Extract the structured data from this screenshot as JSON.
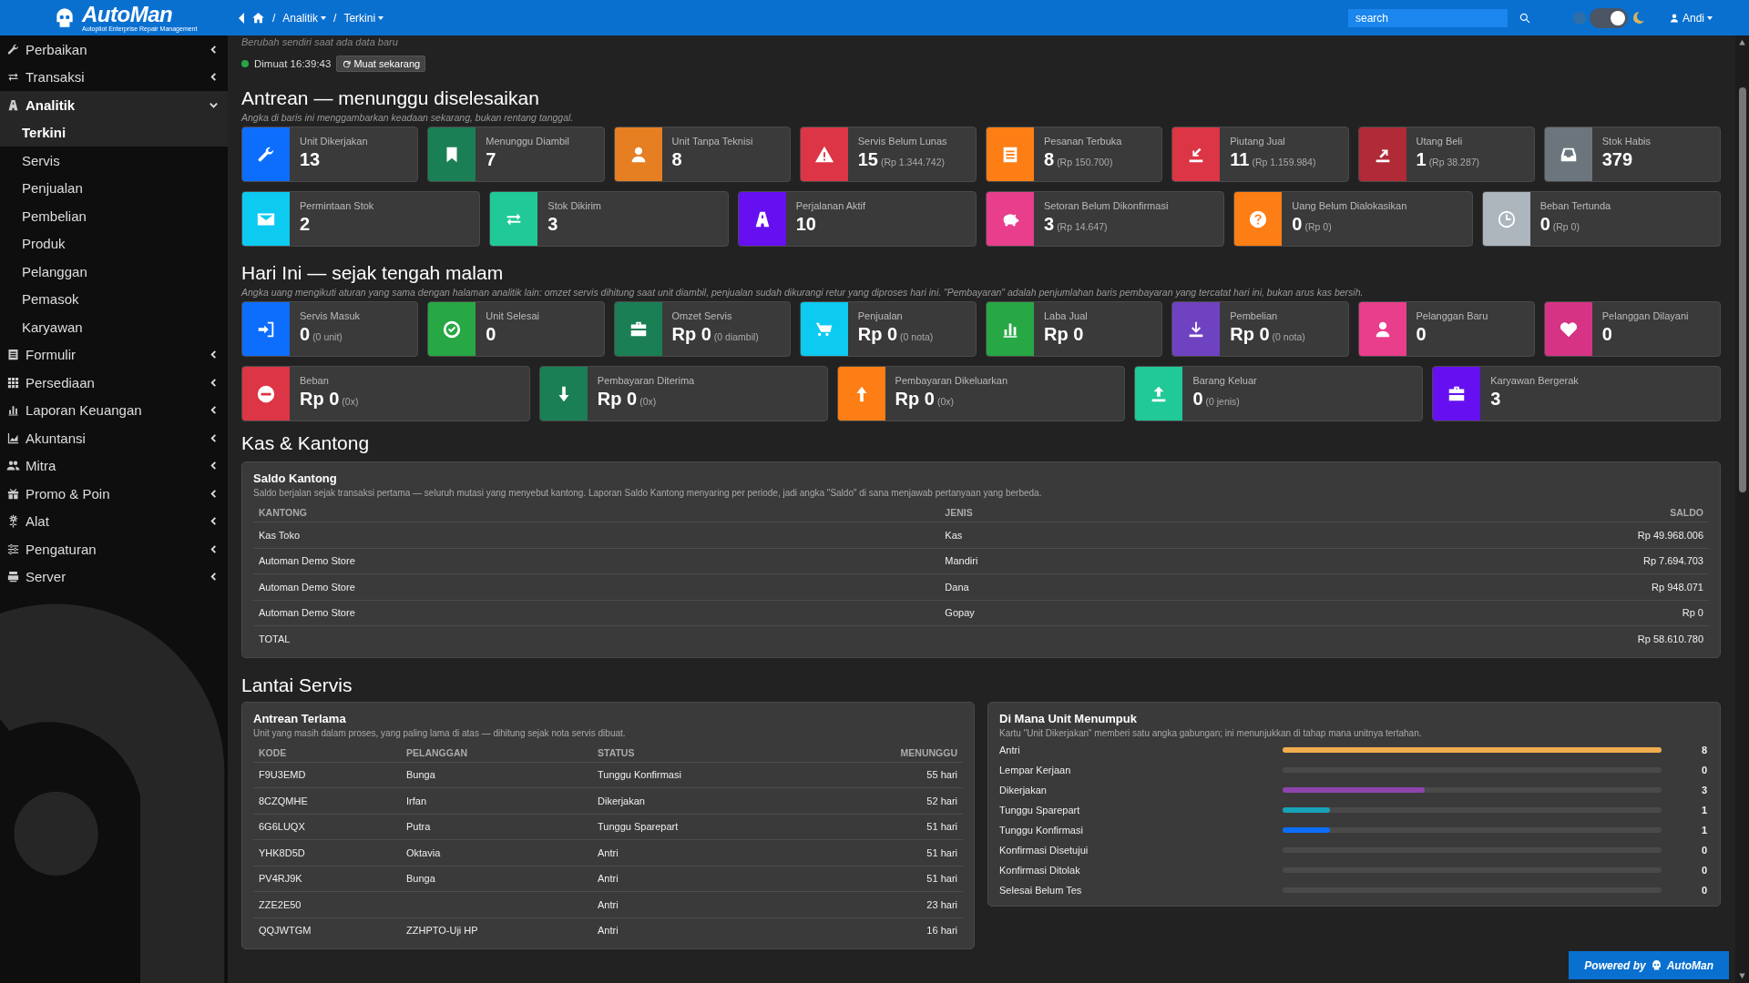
{
  "header": {
    "logo": "AutoMan",
    "tagline": "Autopilot Enterprise Repair Management",
    "breadcrumb": [
      {
        "separator": "/",
        "label": "Analitik"
      },
      {
        "separator": "/",
        "label": "Terkini"
      }
    ],
    "search": {
      "placeholder": "search"
    },
    "dark_mode": true,
    "user": "Andi"
  },
  "sidebar": {
    "items": [
      {
        "label": "Perbaikan",
        "expanded": false
      },
      {
        "label": "Transaksi",
        "expanded": false
      },
      {
        "label": "Analitik",
        "expanded": true,
        "children": [
          {
            "label": "Terkini",
            "selected": true
          },
          {
            "label": "Servis",
            "selected": false
          },
          {
            "label": "Penjualan",
            "selected": false
          },
          {
            "label": "Pembelian",
            "selected": false
          },
          {
            "label": "Produk",
            "selected": false
          },
          {
            "label": "Pelanggan",
            "selected": false
          },
          {
            "label": "Pemasok",
            "selected": false
          },
          {
            "label": "Karyawan",
            "selected": false
          }
        ]
      },
      {
        "label": "Formulir",
        "expanded": false
      },
      {
        "label": "Persediaan",
        "expanded": false
      },
      {
        "label": "Laporan Keuangan",
        "expanded": false
      },
      {
        "label": "Akuntansi",
        "expanded": false
      },
      {
        "label": "Mitra",
        "expanded": false
      },
      {
        "label": "Promo & Poin",
        "expanded": false
      },
      {
        "label": "Alat",
        "expanded": false
      },
      {
        "label": "Pengaturan",
        "expanded": false
      },
      {
        "label": "Server",
        "expanded": false
      }
    ]
  },
  "status": {
    "note": "Berubah sendiri saat ada data baru",
    "live": true,
    "loaded": "Dimuat 16:39:43",
    "reload_button": "Muat sekarang"
  },
  "sections": [
    {
      "title": "Antrean — menunggu diselesaikan",
      "note": "Angka di baris ini menggambarkan keadaan sekarang, bukan rentang tanggal.",
      "rows": [
        {
          "cards": [
            {
              "label": "Unit Dikerjakan",
              "value": "13",
              "color": "#0d6efd"
            },
            {
              "label": "Menunggu Diambil",
              "value": "7",
              "color": "#1b7f55"
            },
            {
              "label": "Unit Tanpa Teknisi",
              "value": "8",
              "color": "#e67e22"
            },
            {
              "label": "Servis Belum Lunas",
              "value": "15",
              "sub": "(Rp 1.344.742)",
              "color": "#dc3545"
            },
            {
              "label": "Pesanan Terbuka",
              "value": "8",
              "sub": "(Rp 150.700)",
              "color": "#fd7e14"
            },
            {
              "label": "Piutang Jual",
              "value": "11",
              "sub": "(Rp 1.159.984)",
              "color": "#dc3545"
            },
            {
              "label": "Utang Beli",
              "value": "1",
              "sub": "(Rp 38.287)",
              "color": "#b02a37"
            },
            {
              "label": "Stok Habis",
              "value": "379",
              "color": "#6c757d"
            }
          ]
        },
        {
          "cards": [
            {
              "label": "Permintaan Stok",
              "value": "2",
              "color": "#0dcaf0"
            },
            {
              "label": "Stok Dikirim",
              "value": "3",
              "color": "#20c997"
            },
            {
              "label": "Perjalanan Aktif",
              "value": "10",
              "color": "#6610f2"
            },
            {
              "label": "Setoran Belum Dikonfirmasi",
              "value": "3",
              "sub": "(Rp 14.647)",
              "color": "#e83e8c"
            },
            {
              "label": "Uang Belum Dialokasikan",
              "value": "0",
              "sub": "(Rp 0)",
              "color": "#fd7e14"
            },
            {
              "label": "Beban Tertunda",
              "value": "0",
              "sub": "(Rp 0)",
              "color": "#adb5bd"
            }
          ]
        }
      ]
    },
    {
      "title": "Hari Ini — sejak tengah malam",
      "note": "Angka uang mengikuti aturan yang sama dengan halaman analitik lain: omzet servis dihitung saat unit diambil, penjualan sudah dikurangi retur yang diproses hari ini. \"Pembayaran\" adalah penjumlahan baris pembayaran yang tercatat hari ini, bukan arus kas bersih.",
      "rows": [
        {
          "cards": [
            {
              "label": "Servis Masuk",
              "value": "0",
              "sub": "(0 unit)",
              "color": "#0d6efd"
            },
            {
              "label": "Unit Selesai",
              "value": "0",
              "color": "#28a745"
            },
            {
              "label": "Omzet Servis",
              "value": "Rp 0",
              "sub": "(0 diambil)",
              "color": "#1b7f55"
            },
            {
              "label": "Penjualan",
              "value": "Rp 0",
              "sub": "(0 nota)",
              "color": "#0dcaf0"
            },
            {
              "label": "Laba Jual",
              "value": "Rp 0",
              "color": "#28a745"
            },
            {
              "label": "Pembelian",
              "value": "Rp 0",
              "sub": "(0 nota)",
              "color": "#6f42c1"
            },
            {
              "label": "Pelanggan Baru",
              "value": "0",
              "color": "#e83e8c"
            },
            {
              "label": "Pelanggan Dilayani",
              "value": "0",
              "color": "#d63384"
            }
          ]
        },
        {
          "cards": [
            {
              "label": "Beban",
              "value": "Rp 0",
              "sub": "(0x)",
              "color": "#dc3545"
            },
            {
              "label": "Pembayaran Diterima",
              "value": "Rp 0",
              "sub": "(0x)",
              "color": "#1b7f55"
            },
            {
              "label": "Pembayaran Dikeluarkan",
              "value": "Rp 0",
              "sub": "(0x)",
              "color": "#fd7e14"
            },
            {
              "label": "Barang Keluar",
              "value": "0",
              "sub": "(0 jenis)",
              "color": "#20c997"
            },
            {
              "label": "Karyawan Bergerak",
              "value": "3",
              "color": "#6610f2"
            }
          ]
        }
      ]
    }
  ],
  "kas": {
    "title": "Kas & Kantong",
    "panel": {
      "title": "Saldo Kantong",
      "note": "Saldo berjalan sejak transaksi pertama — seluruh mutasi yang menyebut kantong. Laporan Saldo Kantong menyaring per periode, jadi angka \"Saldo\" di sana menjawab pertanyaan yang berbeda.",
      "columns": [
        "KANTONG",
        "JENIS",
        "SALDO"
      ],
      "rows": [
        [
          "Kas Toko",
          "Kas",
          "Rp 49.968.006"
        ],
        [
          "Automan Demo Store",
          "Mandiri",
          "Rp 7.694.703"
        ],
        [
          "Automan Demo Store",
          "Dana",
          "Rp 948.071"
        ],
        [
          "Automan Demo Store",
          "Gopay",
          "Rp 0"
        ],
        [
          "TOTAL",
          "",
          "Rp 58.610.780"
        ]
      ]
    }
  },
  "lantai": {
    "title": "Lantai Servis",
    "queue": {
      "title": "Antrean Terlama",
      "note": "Unit yang masih dalam proses, yang paling lama di atas — dihitung sejak nota servis dibuat.",
      "columns": [
        "KODE",
        "PELANGGAN",
        "STATUS",
        "MENUNGGU"
      ],
      "rows": [
        [
          "F9U3EMD",
          "Bunga",
          "Tunggu Konfirmasi",
          "55 hari"
        ],
        [
          "8CZQMHE",
          "Irfan",
          "Dikerjakan",
          "52 hari"
        ],
        [
          "6G6LUQX",
          "Putra",
          "Tunggu Sparepart",
          "51 hari"
        ],
        [
          "YHK8D5D",
          "Oktavia",
          "Antri",
          "51 hari"
        ],
        [
          "PV4RJ9K",
          "Bunga",
          "Antri",
          "51 hari"
        ],
        [
          "ZZE2E50",
          "",
          "Antri",
          "23 hari"
        ],
        [
          "QQJWTGM",
          "ZZHPTO-Uji HP",
          "Antri",
          "16 hari"
        ]
      ]
    },
    "stages": {
      "title": "Di Mana Unit Menumpuk",
      "note": "Kartu \"Unit Dikerjakan\" memberi satu angka gabungan; ini menunjukkan di tahap mana unitnya tertahan.",
      "items": [
        {
          "label": "Antri",
          "count": "8",
          "level": 1,
          "color": "#f0ad4e"
        },
        {
          "label": "Lempar Kerjaan",
          "count": "0",
          "level": 0
        },
        {
          "label": "Dikerjakan",
          "count": "3",
          "level": 0.375,
          "color": "#8e44ad"
        },
        {
          "label": "Tunggu Sparepart",
          "count": "1",
          "level": 0.125,
          "color": "#17a2b8"
        },
        {
          "label": "Tunggu Konfirmasi",
          "count": "1",
          "level": 0.125,
          "color": "#0d6efd"
        },
        {
          "label": "Konfirmasi Disetujui",
          "count": "0",
          "level": 0
        },
        {
          "label": "Konfirmasi Ditolak",
          "count": "0",
          "level": 0
        },
        {
          "label": "Selesai Belum Tes",
          "count": "0",
          "level": 0
        }
      ]
    }
  },
  "powered_by": {
    "text": "Powered by",
    "brand": "AutoMan"
  }
}
